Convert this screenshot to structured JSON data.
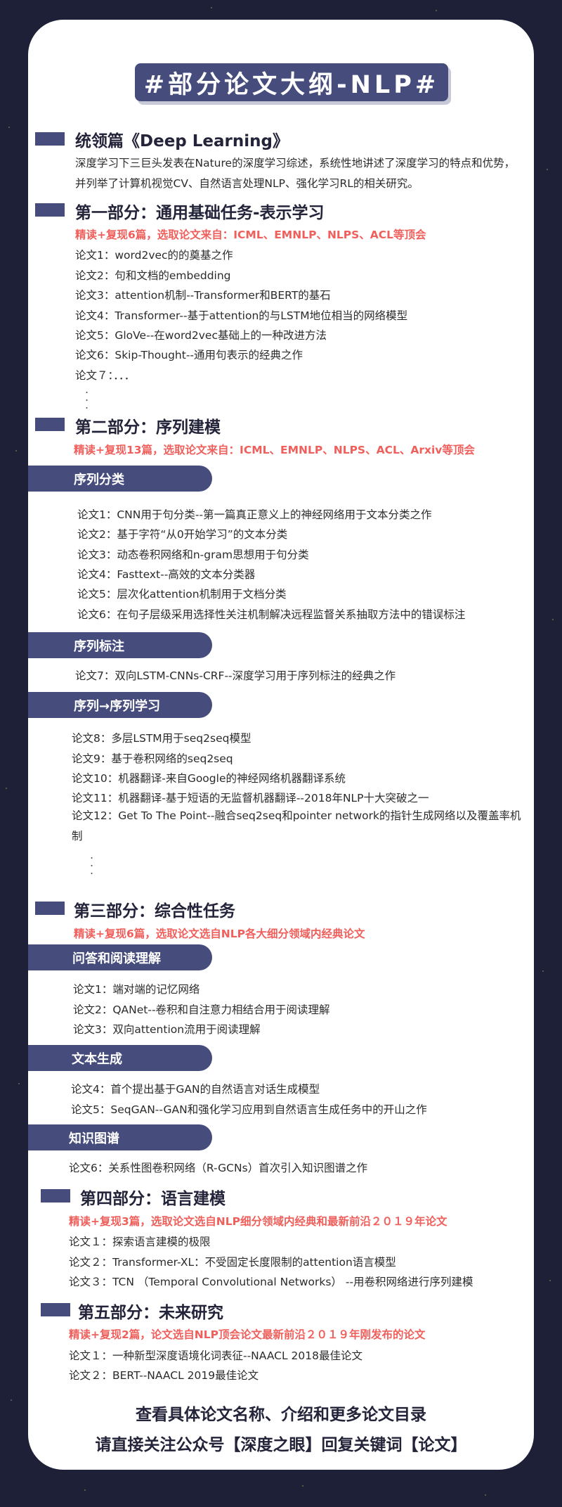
{
  "title": "#部分论文大纲-NLP#",
  "intro": {
    "heading": "统领篇《Deep Learning》",
    "text": "深度学习下三巨头发表在Nature的深度学习综述，系统性地讲述了深度学习的特点和优势，并列举了计算机视觉CV、自然语言处理NLP、强化学习RL的相关研究。"
  },
  "part1": {
    "heading": "第一部分：通用基础任务-表示学习",
    "note": "精读+复现6篇，选取论文来自：ICML、EMNLP、NLPS、ACL等顶会",
    "items": [
      "论文1：word2vec的的奠基之作",
      "论文2：句和文档的embedding",
      "论文3：attention机制--Transformer和BERT的基石",
      "论文4：Transformer--基于attention的与LSTM地位相当的网络模型",
      "论文5：GloVe--在word2vec基础上的一种改进方法",
      "论文6：Skip-Thought--通用句表示的经典之作",
      "论文７：．．．"
    ]
  },
  "part2": {
    "heading": "第二部分：序列建模",
    "note": "精读+复现13篇，选取论文来自：ICML、EMNLP、NLPS、ACL、Arxiv等顶会",
    "sub1": {
      "label": "序列分类",
      "items": [
        "论文1：CNN用于句分类--第一篇真正意义上的神经网络用于文本分类之作",
        "论文2：基于字符“从0开始学习”的文本分类",
        "论文3：动态卷积网络和n-gram思想用于句分类",
        "论文4：Fasttext--高效的文本分类器",
        "论文5：层次化attention机制用于文档分类",
        "论文6：在句子层级采用选择性关注机制解决远程监督关系抽取方法中的错误标注"
      ]
    },
    "sub2": {
      "label": "序列标注",
      "items": [
        "论文7：双向LSTM-CNNs-CRF--深度学习用于序列标注的经典之作"
      ]
    },
    "sub3": {
      "label": "序列→序列学习",
      "items": [
        "论文8：多层LSTM用于seq2seq模型",
        "论文9：基于卷积网络的seq2seq",
        "论文10：机器翻译-来自Google的神经网络机器翻译系统",
        "论文11：机器翻译-基于短语的无监督机器翻译--2018年NLP十大突破之一",
        "论文12：Get To The Point--融合seq2seq和pointer network的指针生成网络以及覆盖率机制"
      ]
    }
  },
  "part3": {
    "heading": "第三部分：综合性任务",
    "note": "精读+复现6篇，选取论文选自NLP各大细分领域内经典论文",
    "sub1": {
      "label": "问答和阅读理解",
      "items": [
        "论文1：端对端的记忆网络",
        "论文2：QANet--卷积和自注意力相结合用于阅读理解",
        "论文3：双向attention流用于阅读理解"
      ]
    },
    "sub2": {
      "label": "文本生成",
      "items": [
        "论文4：首个提出基于GAN的自然语言对话生成模型",
        "论文5：SeqGAN--GAN和强化学习应用到自然语言生成任务中的开山之作"
      ]
    },
    "sub3": {
      "label": "知识图谱",
      "items": [
        "论文6：关系性图卷积网络（R-GCNs）首次引入知识图谱之作"
      ]
    }
  },
  "part4": {
    "heading": "第四部分：语言建模",
    "note": "精读+复现3篇，选取论文选自NLP细分领域内经典和最新前沿２０１９年论文",
    "items": [
      "论文１：探索语言建模的极限",
      "论文２：Transformer-XL：不受固定长度限制的attention语言模型",
      "论文３：TCN （Temporal Convolutional Networks） --用卷积网络进行序列建模"
    ]
  },
  "part5": {
    "heading": "第五部分：未来研究",
    "note": "精读+复现2篇，论文选自NLP顶会论文最新前沿２０１９年刚发布的论文",
    "items": [
      "论文１：一种新型深度语境化词表征--NAACL 2018最佳论文",
      "论文２：BERT--NAACL 2019最佳论文"
    ]
  },
  "footer": {
    "line1": "查看具体论文名称、介绍和更多论文目录",
    "line2": "请直接关注公众号【深度之眼】回复关键词【论文】"
  },
  "colors": {
    "accent": "#464d7d",
    "highlight": "#ef5f5b",
    "background": "#1d2037"
  }
}
